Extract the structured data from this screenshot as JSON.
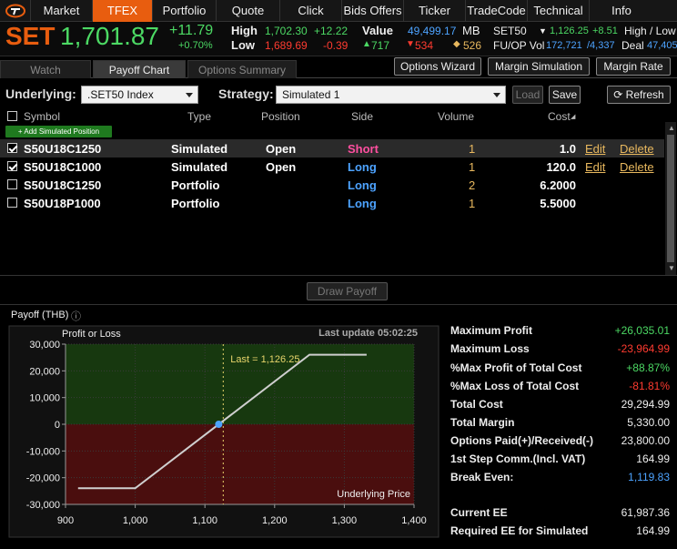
{
  "nav": {
    "tabs": [
      "Market",
      "TFEX",
      "Portfolio",
      "Quote",
      "Click",
      "Bids Offers",
      "Ticker",
      "TradeCode",
      "Technical",
      "Info"
    ],
    "active": "TFEX"
  },
  "quote": {
    "index_name": "SET",
    "index_value": "1,701.87",
    "change": "+11.79",
    "change_pct": "+0.70%",
    "high_label": "High",
    "high_value": "1,702.30",
    "high_change": "+12.22",
    "low_label": "Low",
    "low_value": "1,689.69",
    "low_change": "-0.39",
    "value_label": "Value",
    "value": "49,499.17",
    "value_unit": "MB",
    "up_count": "717",
    "down_count": "534",
    "unch_count": "526",
    "set50_label": "SET50",
    "set50_value": "1,126.25",
    "set50_change": "+8.51",
    "hl_label": "High / Low",
    "fuop_label": "FU/OP Vol",
    "fu_vol": "172,721",
    "op_vol": "/4,337",
    "deal_label": "Deal",
    "deal_value": "47,405"
  },
  "subtabs": {
    "watch": "Watch",
    "payoff": "Payoff Chart",
    "options_summary": "Options Summary"
  },
  "toolbar": {
    "options_wizard": "Options Wizard",
    "margin_simulation": "Margin Simulation",
    "margin_rate": "Margin Rate"
  },
  "form": {
    "underlying_label": "Underlying:",
    "underlying_value": ".SET50 Index",
    "strategy_label": "Strategy:",
    "strategy_value": "Simulated 1",
    "load": "Load",
    "save": "Save",
    "refresh": "Refresh"
  },
  "table": {
    "headers": {
      "symbol": "Symbol",
      "type": "Type",
      "position": "Position",
      "side": "Side",
      "volume": "Volume",
      "cost": "Cost"
    },
    "add_simulated": "+ Add Simulated Position",
    "rows": [
      {
        "checked": true,
        "symbol": "S50U18C1250",
        "type": "Simulated",
        "position": "Open",
        "side": "Short",
        "volume": "1",
        "cost": "1.0",
        "edit": "Edit",
        "delete": "Delete"
      },
      {
        "checked": true,
        "symbol": "S50U18C1000",
        "type": "Simulated",
        "position": "Open",
        "side": "Long",
        "volume": "1",
        "cost": "120.0",
        "edit": "Edit",
        "delete": "Delete"
      },
      {
        "checked": false,
        "symbol": "S50U18C1250",
        "type": "Portfolio",
        "position": "",
        "side": "Long",
        "volume": "2",
        "cost": "6.2000",
        "edit": "",
        "delete": ""
      },
      {
        "checked": false,
        "symbol": "S50U18P1000",
        "type": "Portfolio",
        "position": "",
        "side": "Long",
        "volume": "1",
        "cost": "5.5000",
        "edit": "",
        "delete": ""
      }
    ]
  },
  "draw_payoff": "Draw Payoff",
  "payoff": {
    "title": "Payoff (THB)",
    "last_update": "Last update 05:02:25"
  },
  "chart_data": {
    "type": "line",
    "ylabel": "Profit or Loss",
    "xlabel": "Underlying Price",
    "xlim": [
      900,
      1400
    ],
    "ylim": [
      -30000,
      30000
    ],
    "x_ticks": [
      "900",
      "1,000",
      "1,100",
      "1,200",
      "1,300",
      "1,400"
    ],
    "y_ticks": [
      "30,000",
      "20,000",
      "10,000",
      "0",
      "-10,000",
      "-20,000",
      "-30,000"
    ],
    "series": [
      {
        "x": [
          918,
          1000,
          1250,
          1332
        ],
        "y": [
          -23965,
          -23965,
          26035,
          26035
        ]
      }
    ],
    "last_x": 1126.25,
    "last_label": "Last = 1,126.25",
    "zero_cross_x": 1119.83
  },
  "summary": [
    {
      "label": "Maximum Profit",
      "value": "+26,035.01",
      "color": "#4cd964"
    },
    {
      "label": "Maximum Loss",
      "value": "-23,964.99",
      "color": "#ff3b30"
    },
    {
      "label": "%Max Profit of Total Cost",
      "value": "+88.87%",
      "color": "#4cd964"
    },
    {
      "label": "%Max Loss of Total Cost",
      "value": "-81.81%",
      "color": "#ff3b30"
    },
    {
      "label": "Total Cost",
      "value": "29,294.99",
      "color": "#eeeeee"
    },
    {
      "label": "Total Margin",
      "value": "5,330.00",
      "color": "#eeeeee"
    },
    {
      "label": "Options Paid(+)/Received(-)",
      "value": "23,800.00",
      "color": "#eeeeee"
    },
    {
      "label": "1st Step Comm.(Incl. VAT)",
      "value": "164.99",
      "color": "#eeeeee"
    },
    {
      "label": "Break Even:",
      "value": "1,119.83",
      "color": "#4da3ff"
    },
    {
      "label": "Current EE",
      "value": "61,987.36",
      "color": "#eeeeee"
    },
    {
      "label": "Required EE for Simulated",
      "value": "164.99",
      "color": "#eeeeee"
    }
  ]
}
